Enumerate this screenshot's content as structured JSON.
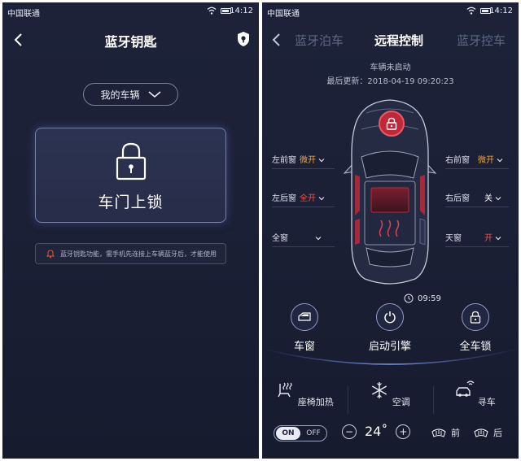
{
  "left_screen": {
    "status_bar": {
      "carrier": "中国联通",
      "time": "14:12"
    },
    "title": "蓝牙钥匙",
    "vehicle_select": {
      "label": "我的车辆"
    },
    "lock_card": {
      "label": "车门上锁"
    },
    "hint": "蓝牙钥匙功能，需手机先连接上车辆蓝牙后，才能使用",
    "icons": [
      "back-icon",
      "shield-icon",
      "chevron-down-icon",
      "lock-icon",
      "bell-icon"
    ]
  },
  "right_screen": {
    "status_bar": {
      "carrier": "中国联通",
      "time": "14:12"
    },
    "tabs": [
      {
        "label": "蓝牙泊车",
        "active": false
      },
      {
        "label": "远程控制",
        "active": true
      },
      {
        "label": "蓝牙控车",
        "active": false
      }
    ],
    "vehicle_status": "车辆未启动",
    "last_update": "最后更新：2018-04-19   09:20:23",
    "windows": {
      "front_left": {
        "label": "左前窗",
        "value": "微开",
        "color": "#f0a23a"
      },
      "front_right": {
        "label": "右前窗",
        "value": "微开",
        "color": "#f0a23a"
      },
      "rear_left": {
        "label": "左后窗",
        "value": "全开",
        "color": "#f0514a"
      },
      "rear_right": {
        "label": "右后窗",
        "value": "关",
        "color": "#ffffff"
      },
      "all": {
        "label": "全窗",
        "value": "",
        "color": "#ffffff"
      },
      "sunroof": {
        "label": "天窗",
        "value": "开",
        "color": "#f0514a"
      }
    },
    "timer": "09:59",
    "controls": [
      {
        "label": "车窗",
        "icon": "car-window-icon"
      },
      {
        "label": "启动引擎",
        "icon": "power-icon"
      },
      {
        "label": "全车锁",
        "icon": "lock-icon"
      }
    ],
    "functions": [
      {
        "label": "座椅加热",
        "icon": "seat-heat-icon"
      },
      {
        "label": "空调",
        "icon": "snowflake-icon"
      },
      {
        "label": "寻车",
        "icon": "find-car-icon"
      }
    ],
    "bottom": {
      "toggle_on": "ON",
      "toggle_off": "OFF",
      "minus": "−",
      "temperature": "24˚",
      "plus": "+",
      "front_defrost": "前",
      "rear_defrost": "后"
    },
    "accent_color": "#c0283a"
  }
}
